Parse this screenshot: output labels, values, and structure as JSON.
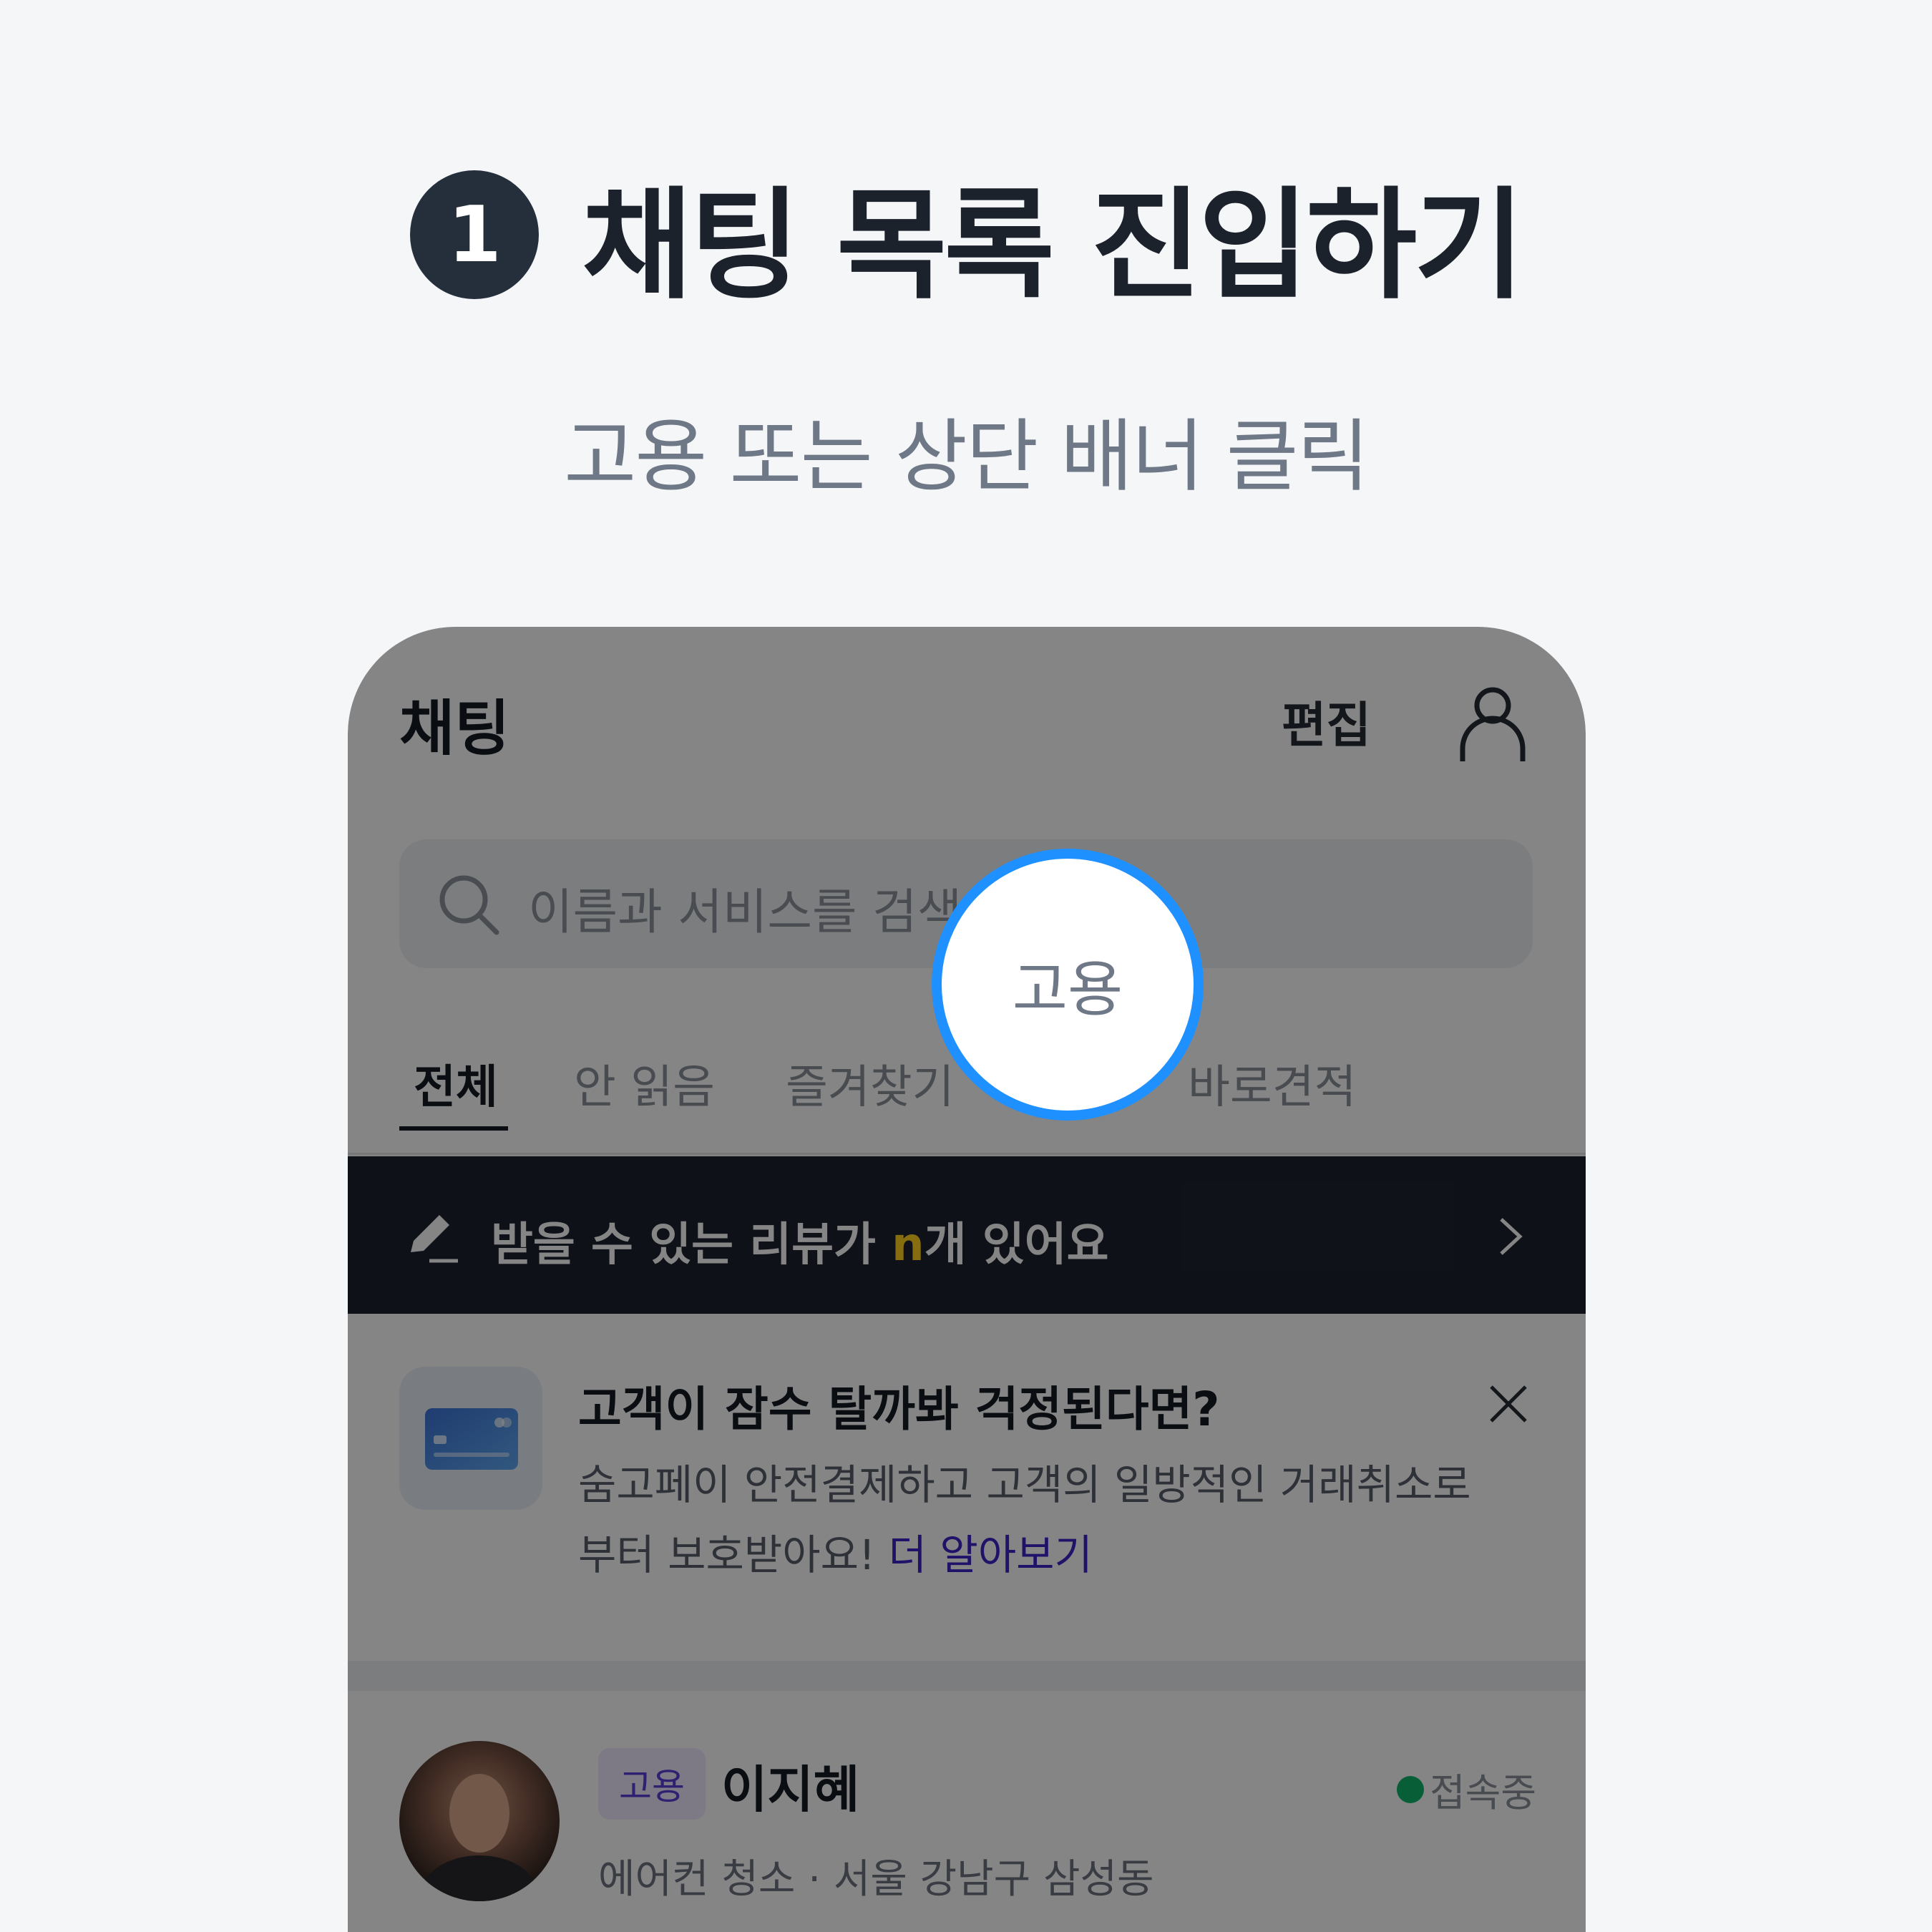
{
  "step": {
    "number": "1",
    "title": "채팅 목록 진입하기"
  },
  "subtitle": "고용 또는 상단 배너 클릭",
  "app": {
    "title": "채팅",
    "edit_label": "편집",
    "search_placeholder": "이름과 서비스를 검색",
    "tabs": [
      {
        "label": "전체",
        "active": true
      },
      {
        "label": "안 읽음"
      },
      {
        "label": "즐겨찾기"
      },
      {
        "label": "바로견적"
      }
    ],
    "review_banner": {
      "prefix": "받을 수 있는 리뷰가 ",
      "count": "n",
      "suffix": "개 있어요"
    },
    "promo": {
      "title": "고객이 잠수 탈까봐 걱정된다면?",
      "description": "숨고페이 안전결제하고 고객의 일방적인 거래취소로 부터 보호받아요! ",
      "link": "더 알아보기"
    },
    "chat": {
      "tag": "고용",
      "name": "이지혜",
      "status": "접속중",
      "description": "에어컨 청소 · 서울 강남구 삼성동"
    }
  },
  "highlight": {
    "label": "고용"
  },
  "colors": {
    "accent_ring": "#1e90ff",
    "banner_bg": "#1c222e",
    "review_count": "#ffd21f",
    "link": "#3d26c9",
    "online": "#10b66a",
    "tag_bg": "#efeaff"
  }
}
